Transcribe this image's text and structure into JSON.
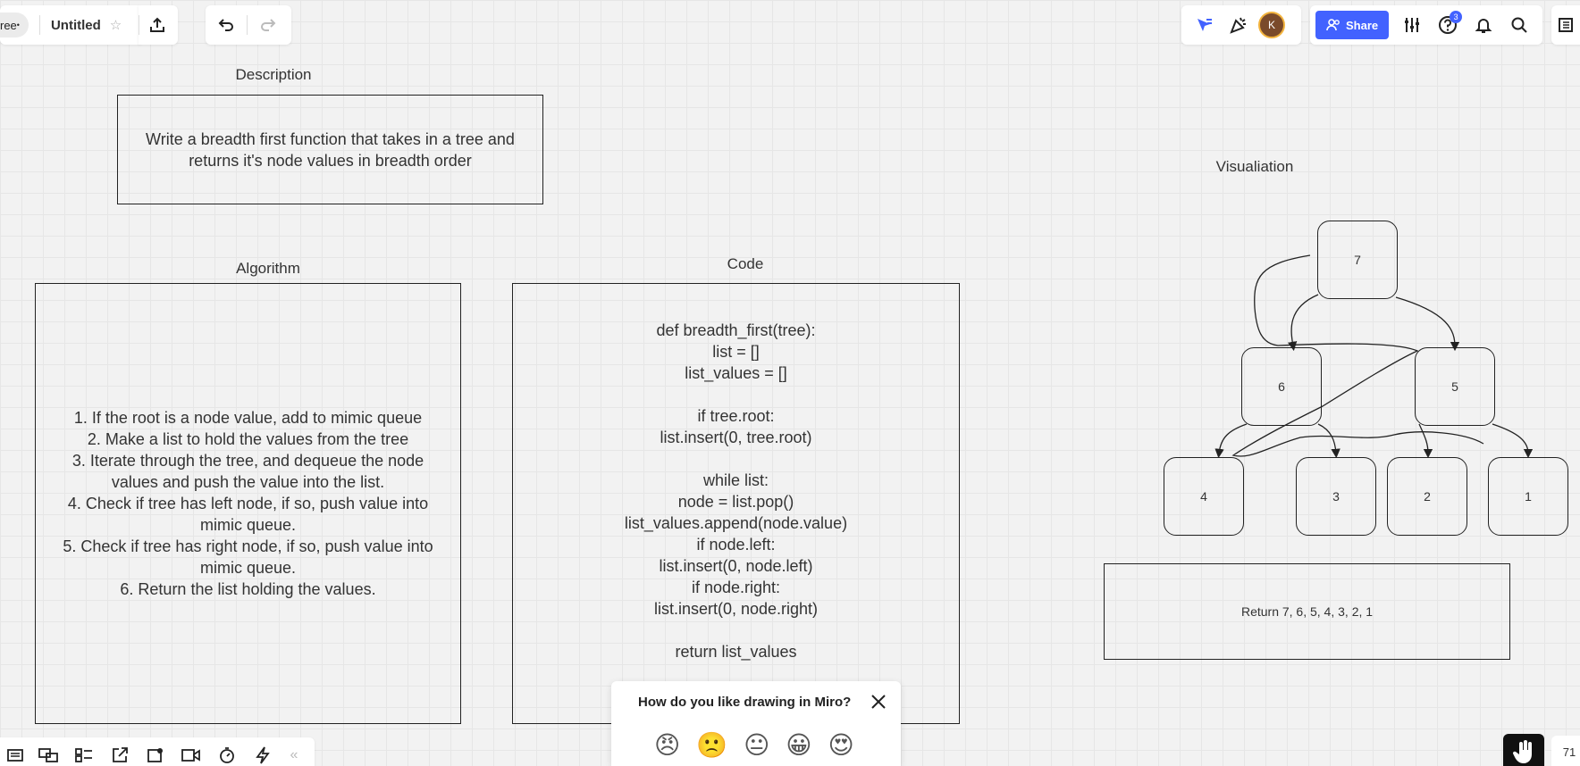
{
  "header": {
    "board_tab": "ree",
    "board_title": "Untitled",
    "share_label": "Share",
    "avatar_initial": "K",
    "help_badge": "3"
  },
  "canvas": {
    "description": {
      "title": "Description",
      "lines": [
        "Write a breadth first function that takes in a tree and",
        "returns it's node values in breadth order"
      ]
    },
    "algorithm": {
      "title": "Algorithm",
      "lines": [
        "1. If the root is a node value, add to mimic queue",
        "2. Make a list to hold the values from the tree",
        "3. Iterate through the tree, and dequeue the node",
        "values and push the value into the list.",
        "4. Check if tree has left node, if so, push value into",
        "mimic queue.",
        "5. Check if tree has right node, if so, push value into",
        "mimic queue.",
        "6. Return the list holding the values."
      ]
    },
    "code": {
      "title": "Code",
      "lines": [
        "def breadth_first(tree):",
        "list = []",
        "list_values = []",
        "",
        "if tree.root:",
        "list.insert(0, tree.root)",
        "",
        "while list:",
        "node = list.pop()",
        "list_values.append(node.value)",
        "if node.left:",
        "list.insert(0, node.left)",
        "if node.right:",
        "list.insert(0, node.right)",
        "",
        "return list_values"
      ]
    },
    "visualization": {
      "title": "Visualiation",
      "nodes": [
        "7",
        "6",
        "5",
        "4",
        "3",
        "2",
        "1"
      ],
      "result": "Return 7, 6, 5, 4, 3, 2, 1"
    }
  },
  "feedback": {
    "question": "How do you like drawing in Miro?",
    "emojis": [
      "😠",
      "🙁",
      "😐",
      "😀",
      "😍"
    ]
  },
  "footer": {
    "zoom": "71"
  }
}
